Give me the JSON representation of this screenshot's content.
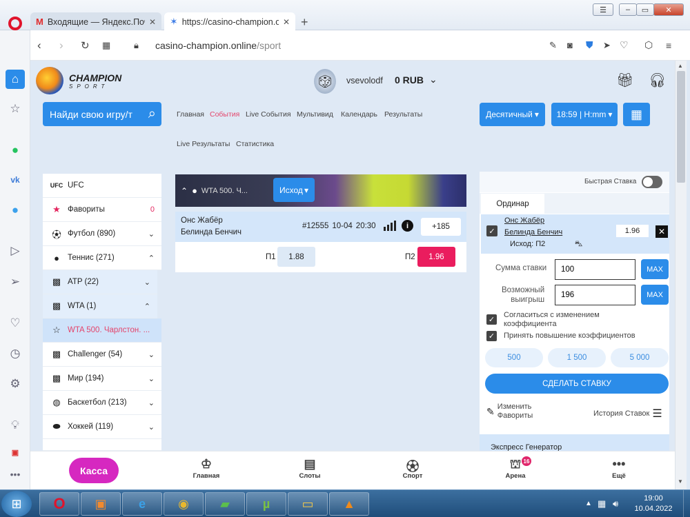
{
  "browser": {
    "tabs": [
      {
        "title": "Входящие — Яндекс.Почта",
        "active": false
      },
      {
        "title": "https://casino-champion.or",
        "active": true
      }
    ],
    "url_domain": "casino-champion.online",
    "url_path": "/sport"
  },
  "site": {
    "logo_title": "CHAMPION",
    "logo_sub": "SPORT",
    "username": "vsevolodf",
    "balance": "0 RUB",
    "search_placeholder": "Найди свою игру/т",
    "nav": [
      "Главная",
      "События",
      "Live События",
      "Мультивид",
      "Календарь",
      "Результаты",
      "Live Результаты",
      "Статистика"
    ],
    "odds_format": "Десятичный",
    "time_format": "18:59 | H:mm"
  },
  "sports": [
    {
      "label": "UFC",
      "icon": "ufc-icon",
      "badge": ""
    },
    {
      "label": "Фавориты",
      "icon": "star-icon",
      "badge": "0"
    },
    {
      "label": "Футбол (890)",
      "icon": "football-icon",
      "badge": ""
    },
    {
      "label": "Теннис (271)",
      "icon": "tennis-icon",
      "badge": ""
    },
    {
      "label": "ATP (22)",
      "icon": "map-icon",
      "badge": ""
    },
    {
      "label": "WTA (1)",
      "icon": "map-icon",
      "badge": ""
    },
    {
      "label": "WTA 500. Чарлстон. ...",
      "icon": "star-outline-icon",
      "badge": ""
    },
    {
      "label": "Challenger (54)",
      "icon": "map-icon",
      "badge": ""
    },
    {
      "label": "Мир (194)",
      "icon": "map-icon",
      "badge": ""
    },
    {
      "label": "Баскетбол (213)",
      "icon": "basketball-icon",
      "badge": ""
    },
    {
      "label": "Хоккей (119)",
      "icon": "hockey-icon",
      "badge": ""
    }
  ],
  "event": {
    "banner_title": "WTA 500. Ч...",
    "outcome_button": "Исход",
    "player1": "Онс Жабёр",
    "player2": "Белинда Бенчич",
    "id": "#12555",
    "date": "10-04",
    "time": "20:30",
    "more": "+185",
    "p1_label": "П1",
    "p1_odds": "1.88",
    "p2_label": "П2",
    "p2_odds": "1.96"
  },
  "betslip": {
    "quick_bet": "Быстрая Ставка",
    "tab": "Ординар",
    "player1": "Онс Жабёр",
    "player2": "Белинда Бенчич",
    "odds": "1.96",
    "outcome": "Исход: П2",
    "stake_label": "Сумма ставки",
    "stake_value": "100",
    "win_label_1": "Возможный",
    "win_label_2": "выигрыш",
    "win_value": "196",
    "max": "MAX",
    "accept_change_1": "Согласиться с изменением",
    "accept_change_2": "коэффициента",
    "accept_increase": "Принять повышение коэффициентов",
    "quick_amounts": [
      "500",
      "1 500",
      "5 000"
    ],
    "place_bet": "СДЕЛАТЬ СТАВКУ",
    "edit_favorites_1": "Изменить",
    "edit_favorites_2": "Фавориты",
    "history": "История Ставок",
    "express": "Экспресс Генератор"
  },
  "bottom_nav": {
    "kassa": "Касса",
    "items": [
      "Главная",
      "Слоты",
      "Спорт",
      "Арена",
      "Ещё"
    ],
    "arena_badge": "16"
  },
  "taskbar": {
    "time": "19:00",
    "date": "10.04.2022"
  },
  "colors": {
    "accent": "#2b8ce9",
    "odds_selected": "#ea1d5e",
    "kassa": "#d628c0"
  }
}
